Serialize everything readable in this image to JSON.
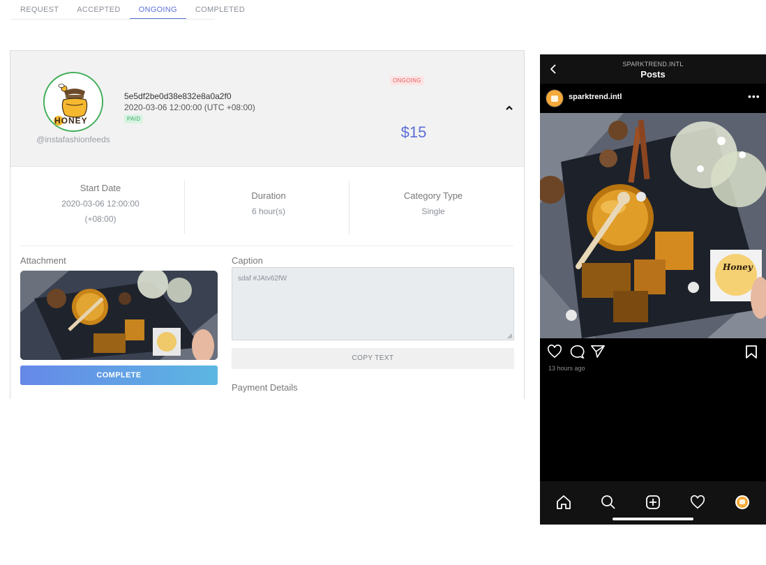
{
  "tabs": [
    {
      "label": "REQUEST"
    },
    {
      "label": "ACCEPTED"
    },
    {
      "label": "ONGOING"
    },
    {
      "label": "COMPLETED"
    }
  ],
  "order": {
    "handle": "@instafashionfeeds",
    "logo_text": "HONEY",
    "id": "5e5df2be0d38e832e8a0a2f0",
    "date": "2020-03-06 12:00:00 (UTC +08:00)",
    "payment_badge": "PAID",
    "status_badge": "ONGOING",
    "price": "$15",
    "accent_color": "#5b6fd6"
  },
  "stats": {
    "start_date_title": "Start Date",
    "start_date_value": "2020-03-06 12:00:00",
    "start_date_tz": "(+08:00)",
    "duration_title": "Duration",
    "duration_value": "6 hour(s)",
    "category_title": "Category Type",
    "category_value": "Single"
  },
  "attachment": {
    "label": "Attachment",
    "complete_button": "COMPLETE"
  },
  "caption": {
    "label": "Caption",
    "text": "sdaf #JAtv62fW",
    "copy_button": "COPY TEXT"
  },
  "payment": {
    "label": "Payment Details"
  },
  "phone": {
    "account": "SPARKTREND.INTL",
    "title": "Posts",
    "username": "sparktrend.intl",
    "more_icon": "•••",
    "post_overlay_text": "Honey",
    "time_ago": "13 hours ago"
  }
}
